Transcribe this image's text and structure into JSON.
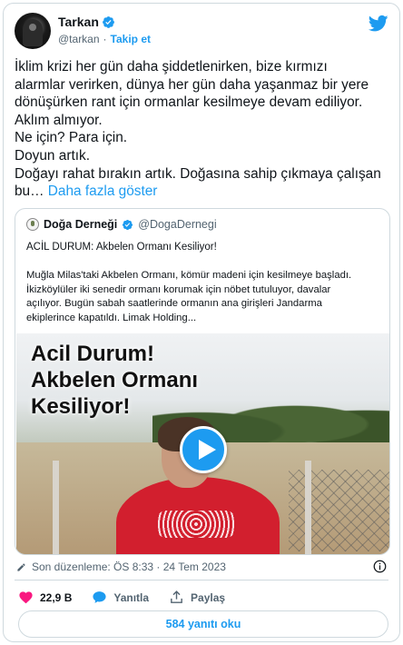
{
  "author": {
    "name": "Tarkan",
    "handle": "@tarkan",
    "separator": "·",
    "follow_label": "Takip et"
  },
  "tweet": {
    "lines": [
      "İklim krizi her gün daha şiddetlenirken, bize kırmızı",
      "alarmlar verirken, dünya her gün daha yaşanmaz bir yere",
      "dönüşürken rant için ormanlar kesilmeye devam ediliyor.",
      "Aklım almıyor.",
      "Ne için? Para için.",
      "Doyun artık.",
      "Doğayı rahat bırakın artık. Doğasına sahip çıkmaya çalışan",
      "bu…"
    ],
    "show_more": "Daha fazla göster"
  },
  "quote": {
    "name": "Doğa Derneği",
    "handle": "@DogaDernegi",
    "title": "ACİL DURUM: Akbelen Ormanı Kesiliyor!",
    "body_lines": [
      "Muğla Milas'taki Akbelen Ormanı, kömür madeni için kesilmeye başladı.",
      "İkizköylüler iki senedir ormanı korumak için nöbet tutuluyor, davalar",
      "açılıyor. Bugün sabah saatlerinde ormanın ana girişleri Jandarma",
      "ekiplerince kapatıldı. Limak Holding..."
    ],
    "video_title_lines": [
      "Acil Durum!",
      "Akbelen Ormanı",
      "Kesiliyor!"
    ]
  },
  "edited": "Son düzenleme: ÖS 8:33 · 24 Tem 2023",
  "actions": {
    "likes": "22,9 B",
    "reply_label": "Yanıtla",
    "share_label": "Paylaş"
  },
  "replies_button": "584 yanıtı oku",
  "colors": {
    "accent": "#1d9bf0",
    "like": "#f91880",
    "text": "#0f1419",
    "muted": "#536471"
  }
}
